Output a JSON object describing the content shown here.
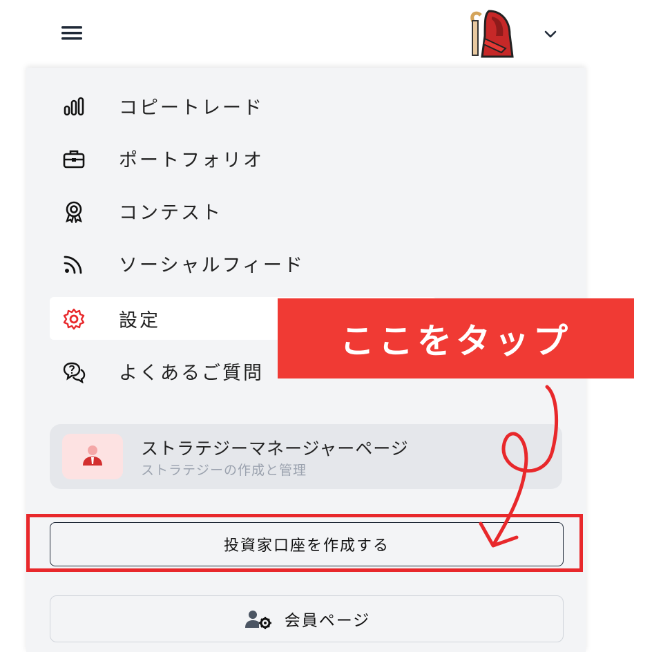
{
  "colors": {
    "accent": "#e8282b",
    "callout_bg": "#f03a34",
    "drawer_bg": "#f3f4f6",
    "manager_card_bg": "#e5e7eb",
    "muted_text": "#9ca3af"
  },
  "header": {
    "menu_icon": "hamburger-menu-icon",
    "avatar_icon": "red-hooded-figure-avatar",
    "dropdown_icon": "chevron-down-icon"
  },
  "nav": {
    "items": [
      {
        "label": "コピートレード",
        "icon": "bar-chart-icon"
      },
      {
        "label": "ポートフォリオ",
        "icon": "briefcase-icon"
      },
      {
        "label": "コンテスト",
        "icon": "award-medal-icon"
      },
      {
        "label": "ソーシャルフィード",
        "icon": "rss-feed-icon"
      },
      {
        "label": "設定",
        "icon": "gear-icon",
        "active": true
      },
      {
        "label": "よくあるご質問",
        "icon": "question-chat-icon"
      }
    ]
  },
  "manager_card": {
    "title": "ストラテジーマネージャーページ",
    "subtitle": "ストラテジーの作成と管理",
    "icon": "manager-person-icon"
  },
  "buttons": {
    "create_investor_account": "投資家口座を作成する",
    "member_page": "会員ページ",
    "member_icon": "user-gear-icon"
  },
  "annotation": {
    "callout_text": "ここをタップ"
  }
}
